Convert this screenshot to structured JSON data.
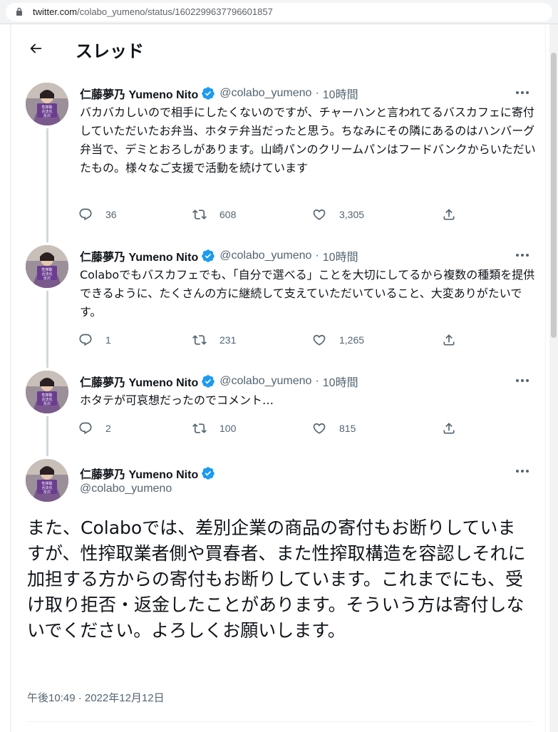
{
  "browser": {
    "url_host": "twitter.com",
    "url_path": "/colabo_yumeno/status/1602299637796601857"
  },
  "header": {
    "title": "スレッド"
  },
  "author": {
    "name": "仁藤夢乃 Yumeno Nito",
    "handle": "@colabo_yumeno",
    "avatar_sign_text": "性搾取 合法化 反対"
  },
  "tweets": [
    {
      "time": "10時間",
      "text": "バカバカしいので相手にしたくないのですが、チャーハンと言われてるバスカフェに寄付していただいたお弁当、ホタテ弁当だったと思う。ちなみにその隣にあるのはハンバーグ弁当で、デミとおろしがあります。山崎パンのクリームパンはフードバンクからいただいたもの。様々なご支援で活動を続けています",
      "replies": "36",
      "retweets": "608",
      "likes": "3,305"
    },
    {
      "time": "10時間",
      "text": "Colaboでもバスカフェでも、「自分で選べる」ことを大切にしてるから複数の種類を提供できるように、たくさんの方に継続して支えていただいていること、大変ありがたいです。",
      "replies": "1",
      "retweets": "231",
      "likes": "1,265"
    },
    {
      "time": "10時間",
      "text": "ホタテが可哀想だったのでコメント…",
      "replies": "2",
      "retweets": "100",
      "likes": "815"
    }
  ],
  "main_tweet": {
    "text": "また、Colaboでは、差別企業の商品の寄付もお断りしていますが、性搾取業者側や買春者、また性搾取構造を容認しそれに加担する方からの寄付もお断りしています。これまでにも、受け取り拒否・返金したことがあります。そういう方は寄付しないでください。よろしくお願いします。",
    "timestamp": "午後10:49 · 2022年12月12日"
  },
  "separator": "·",
  "icons": {
    "back": "arrow-left-icon",
    "verified": "verified-badge-icon",
    "more": "more-horizontal-icon",
    "reply": "reply-icon",
    "retweet": "retweet-icon",
    "like": "heart-icon",
    "share": "share-icon",
    "lock": "lock-icon"
  },
  "colors": {
    "verified_blue": "#1d9bf0",
    "secondary_text": "#536471",
    "thread_line": "#cfd9de"
  }
}
